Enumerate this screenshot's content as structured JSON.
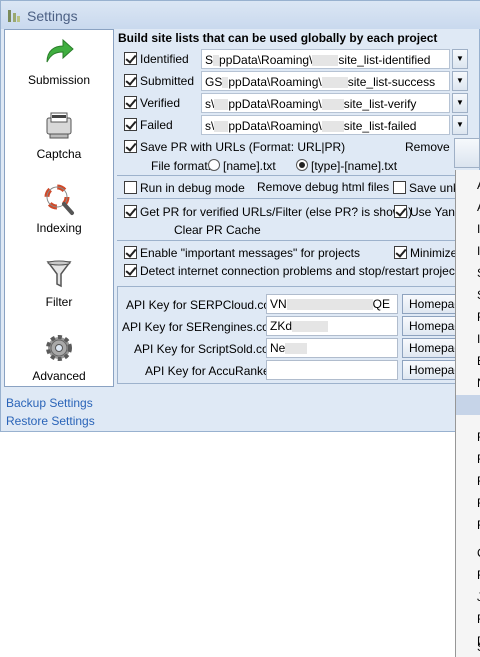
{
  "window": {
    "title": "Settings"
  },
  "sidebar": {
    "items": [
      {
        "label": "Submission",
        "icon": "green-arrow-icon"
      },
      {
        "label": "Captcha",
        "icon": "captcha-printer-icon"
      },
      {
        "label": "Indexing",
        "icon": "lifebuoy-magnifier-icon"
      },
      {
        "label": "Filter",
        "icon": "funnel-icon"
      },
      {
        "label": "Advanced",
        "icon": "gear-icon"
      }
    ],
    "links": {
      "backup": "Backup Settings",
      "restore": "Restore Settings"
    }
  },
  "main": {
    "heading": "Build site lists that can be used globally by each project",
    "sitelists": [
      {
        "label": "Identified",
        "checked": true,
        "path_start": "S",
        "path_mid": "ppData\\Roaming\\",
        "path_end": "site_list-identified"
      },
      {
        "label": "Submitted",
        "checked": true,
        "path_start": "GS",
        "path_mid": "ppData\\Roaming\\",
        "path_end": "site_list-success"
      },
      {
        "label": "Verified",
        "checked": true,
        "path_start": "s\\",
        "path_mid": "ppData\\Roaming\\",
        "path_end": "site_list-verify"
      },
      {
        "label": "Failed",
        "checked": true,
        "path_start": "s\\",
        "path_mid": "ppData\\Roaming\\",
        "path_end": "site_list-failed"
      }
    ],
    "save_pr": {
      "label": "Save PR with URLs (Format: URL|PR)",
      "checked": true
    },
    "remove_label": "Remove",
    "file_format": {
      "label": "File format:",
      "options": [
        "[name].txt",
        "[type]-[name].txt"
      ],
      "selected": 1
    },
    "debug": {
      "run_label": "Run in debug mode",
      "run_checked": false,
      "remove_label": "Remove debug html files",
      "save_label": "Save unk",
      "save_checked": false
    },
    "pr": {
      "get_label": "Get PR for verified URLs/Filter  (else PR? is shown)",
      "get_checked": true,
      "use_label": "Use Yan",
      "use_checked": true,
      "clear_label": "Clear PR Cache"
    },
    "messages": {
      "enable_label": "Enable \"important messages\" for projects",
      "enable_checked": true,
      "minimize_label": "Minimize",
      "minimize_checked": true,
      "detect_label": "Detect internet connection problems and stop/restart projects",
      "detect_checked": true
    },
    "api_keys": [
      {
        "label": "API Key for SERPCloud.com",
        "value": "VN",
        "value_end": "QE",
        "button": "Homepage"
      },
      {
        "label": "API Key for SERengines.com",
        "value": "ZKd",
        "value_end": "",
        "button": "Homepage"
      },
      {
        "label": "API Key for ScriptSold.com",
        "value": "Ne",
        "value_end": "",
        "button": "Homepage"
      },
      {
        "label": "API Key for AccuRanker",
        "value": "",
        "value_end": "",
        "button": "Homepage"
      }
    ]
  },
  "context_menu": {
    "visible_letters": [
      "A",
      "A",
      "I",
      "I",
      "S",
      "S",
      "F",
      "I",
      "E",
      "N",
      "F",
      "F",
      "F",
      "F",
      "F",
      "C",
      "F",
      "J",
      "F",
      "D",
      "S"
    ]
  }
}
